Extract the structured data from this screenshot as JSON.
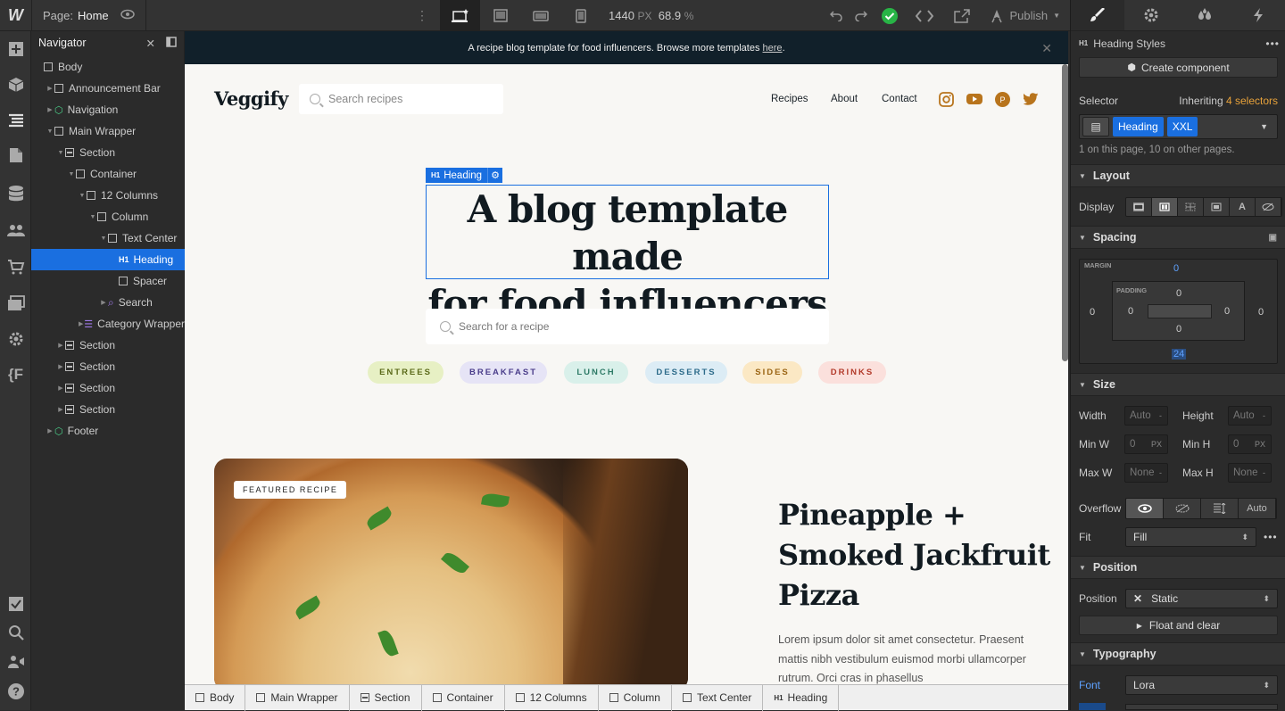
{
  "topbar": {
    "logo": "W",
    "page_label": "Page:",
    "page_name": "Home",
    "canvas_width": "1440",
    "width_unit": "PX",
    "zoom": "68.9",
    "zoom_unit": "%",
    "publish": "Publish"
  },
  "navigator": {
    "title": "Navigator",
    "tree": [
      {
        "label": "Body",
        "icon": "box",
        "indent": 0,
        "caret": ""
      },
      {
        "label": "Announcement Bar",
        "icon": "box",
        "indent": 1,
        "caret": "▶"
      },
      {
        "label": "Navigation",
        "icon": "component",
        "indent": 1,
        "caret": "▶"
      },
      {
        "label": "Main Wrapper",
        "icon": "box",
        "indent": 1,
        "caret": "▼"
      },
      {
        "label": "Section",
        "icon": "section",
        "indent": 2,
        "caret": "▼"
      },
      {
        "label": "Container",
        "icon": "box",
        "indent": 3,
        "caret": "▼"
      },
      {
        "label": "12 Columns",
        "icon": "box",
        "indent": 4,
        "caret": "▼"
      },
      {
        "label": "Column",
        "icon": "box",
        "indent": 5,
        "caret": "▼"
      },
      {
        "label": "Text Center",
        "icon": "box",
        "indent": 6,
        "caret": "▼"
      },
      {
        "label": "Heading",
        "icon": "h1",
        "indent": 7,
        "caret": "",
        "selected": true
      },
      {
        "label": "Spacer",
        "icon": "box",
        "indent": 7,
        "caret": ""
      },
      {
        "label": "Search",
        "icon": "search",
        "indent": 6,
        "caret": "▶"
      },
      {
        "label": "Category Wrapper",
        "icon": "collection",
        "indent": 4,
        "caret": "▶"
      },
      {
        "label": "Section",
        "icon": "section",
        "indent": 2,
        "caret": "▶"
      },
      {
        "label": "Section",
        "icon": "section",
        "indent": 2,
        "caret": "▶"
      },
      {
        "label": "Section",
        "icon": "section",
        "indent": 2,
        "caret": "▶"
      },
      {
        "label": "Section",
        "icon": "section",
        "indent": 2,
        "caret": "▶"
      },
      {
        "label": "Footer",
        "icon": "component",
        "indent": 1,
        "caret": "▶"
      }
    ]
  },
  "site": {
    "announcement": "A recipe blog template for food influencers. Browse more templates ",
    "announcement_link": "here",
    "announcement_end": ".",
    "logo": "Veggify",
    "nav_search_placeholder": "Search recipes",
    "menu": [
      "Recipes",
      "About",
      "Contact"
    ],
    "social": [
      "instagram-icon",
      "youtube-icon",
      "pinterest-icon",
      "twitter-icon"
    ],
    "brand_color": "#b8741c",
    "heading_tag_h": "H1",
    "heading_tag": "Heading",
    "hero_line1": "A blog template made",
    "hero_line2": "for food influencers",
    "hero_search_placeholder": "Search for a recipe",
    "categories": [
      {
        "label": "ENTREES",
        "bg": "#e7f0c4",
        "fg": "#5b6a1a"
      },
      {
        "label": "BREAKFAST",
        "bg": "#e6e4f6",
        "fg": "#4a3d8a"
      },
      {
        "label": "LUNCH",
        "bg": "#d9f0ea",
        "fg": "#2d7a66"
      },
      {
        "label": "DESSERTS",
        "bg": "#dcecf5",
        "fg": "#2d6b8a"
      },
      {
        "label": "SIDES",
        "bg": "#fbe8c4",
        "fg": "#9a6413"
      },
      {
        "label": "DRINKS",
        "bg": "#fbe0dc",
        "fg": "#b23a2a"
      }
    ],
    "featured_label": "FEATURED RECIPE",
    "featured_title": "Pineapple + Smoked Jackfruit Pizza",
    "featured_body": "Lorem ipsum dolor sit amet consectetur. Praesent mattis nibh vestibulum euismod morbi ullamcorper rutrum. Orci cras in phasellus"
  },
  "breadcrumbs": [
    {
      "label": "Body",
      "icon": "box"
    },
    {
      "label": "Main Wrapper",
      "icon": "box"
    },
    {
      "label": "Section",
      "icon": "section"
    },
    {
      "label": "Container",
      "icon": "box"
    },
    {
      "label": "12 Columns",
      "icon": "box"
    },
    {
      "label": "Column",
      "icon": "box"
    },
    {
      "label": "Text Center",
      "icon": "box"
    },
    {
      "label": "Heading",
      "icon": "h1"
    }
  ],
  "panel": {
    "element_tag": "H1",
    "element_title": "Heading Styles",
    "create_component": "Create component",
    "selector_label": "Selector",
    "inheriting": "Inheriting",
    "inheriting_count": "4 selectors",
    "selector_chips": [
      "Heading",
      "XXL"
    ],
    "usage": "1 on this page, 10 on other pages.",
    "layout": "Layout",
    "display": "Display",
    "spacing": "Spacing",
    "margin": "MARGIN",
    "padding": "PADDING",
    "margin_top": "0",
    "margin_left": "0",
    "margin_right": "0",
    "margin_bottom": "24",
    "padding_top": "0",
    "padding_left": "0",
    "padding_right": "0",
    "padding_bottom": "0",
    "size": "Size",
    "width": "Width",
    "height": "Height",
    "auto": "Auto",
    "dash": "-",
    "min_w": "Min W",
    "min_h": "Min H",
    "zero": "0",
    "px": "PX",
    "max_w": "Max W",
    "max_h": "Max H",
    "none": "None",
    "overflow": "Overflow",
    "overflow_auto": "Auto",
    "fit": "Fit",
    "fit_value": "Fill",
    "position_section": "Position",
    "position_label": "Position",
    "position_value": "Static",
    "float_clear": "Float and clear",
    "typography": "Typography",
    "font": "Font",
    "font_value": "Lora",
    "accent_color": "#1a6fe0"
  }
}
